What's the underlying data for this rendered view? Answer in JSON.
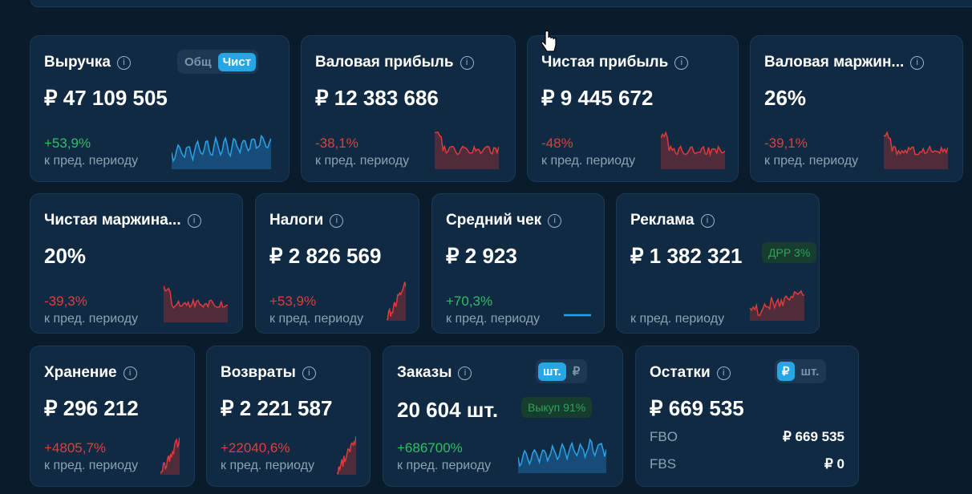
{
  "cards": {
    "revenue": {
      "title": "Выручка",
      "value": "₽ 47 109 505",
      "change": "+53,9%",
      "sub": "к пред. периоду",
      "toggle": [
        "Общ",
        "Чист"
      ]
    },
    "gross_profit": {
      "title": "Валовая прибыль",
      "value": "₽ 12 383 686",
      "change": "-38,1%",
      "sub": "к пред. периоду"
    },
    "net_profit": {
      "title": "Чистая прибыль",
      "value": "₽ 9 445 672",
      "change": "-48%",
      "sub": "к пред. периоду"
    },
    "gross_margin": {
      "title": "Валовая маржин...",
      "value": "26%",
      "change": "-39,1%",
      "sub": "к пред. периоду"
    },
    "net_margin": {
      "title": "Чистая маржина...",
      "value": "20%",
      "change": "-39,3%",
      "sub": "к пред. периоду"
    },
    "taxes": {
      "title": "Налоги",
      "value": "₽ 2 826 569",
      "change": "+53,9%",
      "sub": "к пред. периоду"
    },
    "avg_check": {
      "title": "Средний чек",
      "value": "₽ 2 923",
      "change": "+70,3%",
      "sub": "к пред. периоду"
    },
    "ads": {
      "title": "Реклама",
      "value": "₽ 1 382 321",
      "badge": "ДРР 3%",
      "sub": "к пред. периоду"
    },
    "storage": {
      "title": "Хранение",
      "value": "₽ 296 212",
      "change": "+4805,7%",
      "sub": "к пред. периоду"
    },
    "returns": {
      "title": "Возвраты",
      "value": "₽ 2 221 587",
      "change": "+22040,6%",
      "sub": "к пред. периоду"
    },
    "orders": {
      "title": "Заказы",
      "value": "20 604 шт.",
      "badge": "Выкуп 91%",
      "change": "+686700%",
      "sub": "к пред. периоду",
      "toggle": [
        "шт.",
        "₽"
      ]
    },
    "stock": {
      "title": "Остатки",
      "value": "₽ 669 535",
      "toggle": [
        "₽",
        "шт."
      ],
      "rows": [
        {
          "label": "FBO",
          "value": "₽ 669 535"
        },
        {
          "label": "FBS",
          "value": "₽ 0"
        }
      ]
    }
  },
  "icons": {
    "info": "info-icon",
    "cursor": "hand-pointer-icon"
  },
  "colors": {
    "up": "#2fbf63",
    "down": "#e23d3d",
    "accent": "#27a6e6"
  }
}
